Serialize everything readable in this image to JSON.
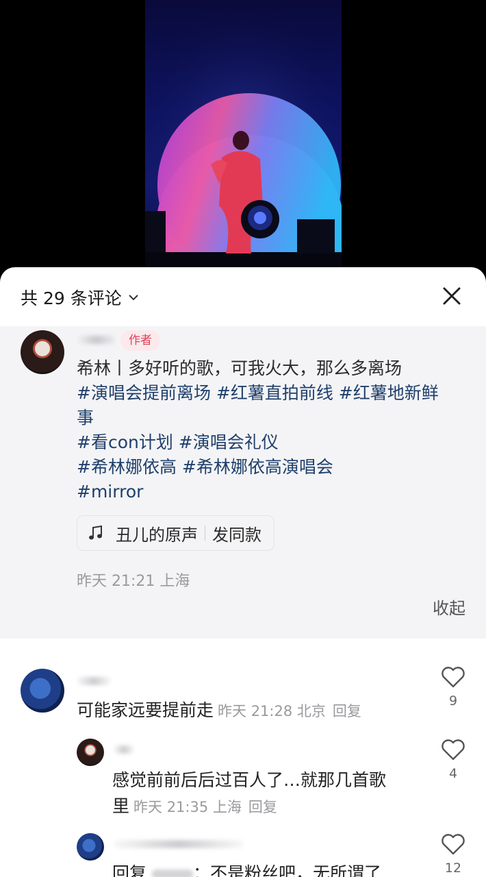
{
  "video": {},
  "sheet": {
    "count_title": "共 29 条评论",
    "close_icon": "close-icon"
  },
  "op": {
    "author_tag": "作者",
    "lines": [
      "希林丨多好听的歌，可我火大，那么多离场",
      "#演唱会提前离场 #红薯直拍前线 #红薯地新鲜",
      "事",
      "#看con计划 #演唱会礼仪",
      "#希林娜依高 #希林娜依高演唱会",
      "#mirror"
    ],
    "sound_label": "丑儿的原声",
    "sound_action": "发同款",
    "meta": "昨天 21:21 上海",
    "collapse": "收起"
  },
  "comments": [
    {
      "text": "可能家远要提前走",
      "meta": "昨天 21:28 北京",
      "reply": "回复",
      "likes": "9"
    },
    {
      "text_line1": "感觉前前后后过百人了…就那几首歌",
      "text_line2": "里",
      "meta": "昨天 21:35 上海",
      "reply": "回复",
      "likes": "4"
    },
    {
      "text_a": "回复",
      "text_b": "：不是粉丝吧，无所谓了",
      "likes": "12"
    }
  ]
}
